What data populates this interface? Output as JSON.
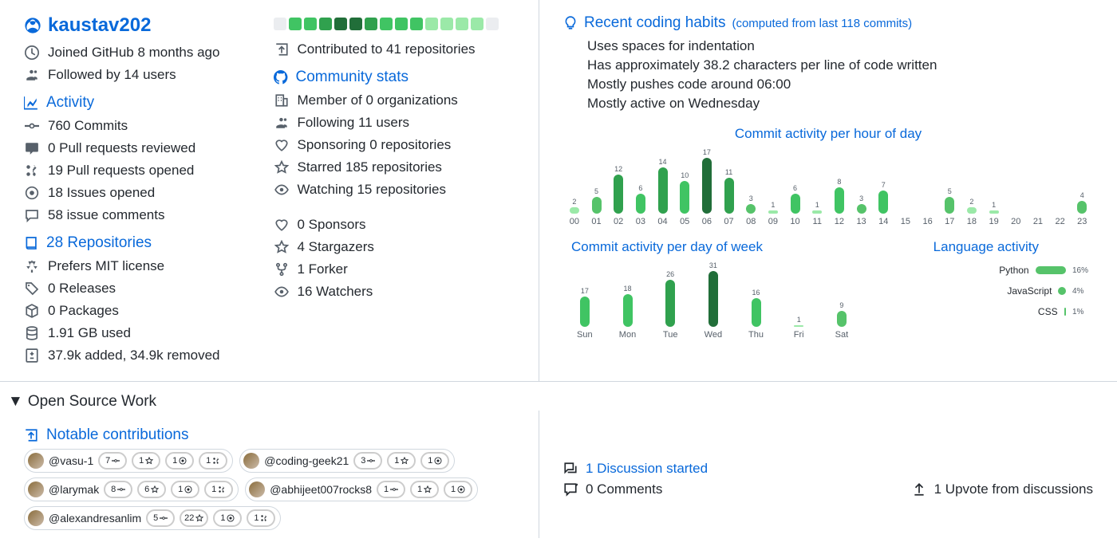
{
  "profile": {
    "username": "kaustav202",
    "joined": "Joined GitHub 8 months ago",
    "followed": "Followed by 14 users",
    "contributed": "Contributed to 41 repositories"
  },
  "activity": {
    "title": "Activity",
    "commits": "760 Commits",
    "pr_reviewed": "0 Pull requests reviewed",
    "pr_opened": "19 Pull requests opened",
    "issues": "18 Issues opened",
    "comments": "58 issue comments"
  },
  "community": {
    "title": "Community stats",
    "orgs": "Member of 0 organizations",
    "following": "Following 11 users",
    "sponsoring": "Sponsoring 0 repositories",
    "starred": "Starred 185 repositories",
    "watching": "Watching 15 repositories"
  },
  "repos": {
    "title": "28 Repositories",
    "license": "Prefers MIT license",
    "releases": "0 Releases",
    "packages": "0 Packages",
    "disk": "1.91 GB used",
    "diff": "37.9k added, 34.9k removed"
  },
  "repostats": {
    "sponsors": "0 Sponsors",
    "stargazers": "4 Stargazers",
    "forker": "1 Forker",
    "watchers": "16 Watchers"
  },
  "squares": [
    "#ebedf0",
    "#40c463",
    "#40c463",
    "#30a14e",
    "#216e39",
    "#216e39",
    "#30a14e",
    "#40c463",
    "#40c463",
    "#40c463",
    "#9be9a8",
    "#9be9a8",
    "#9be9a8",
    "#9be9a8",
    "#ebedf0"
  ],
  "habits": {
    "title": "Recent coding habits",
    "subtitle": "(computed from last 118 commits)",
    "items": [
      "Uses spaces for indentation",
      "Has approximately 38.2 characters per line of code written",
      "Mostly pushes code around 06:00",
      "Mostly active on Wednesday"
    ]
  },
  "chart_data": [
    {
      "type": "bar",
      "title": "Commit activity per hour of day",
      "categories": [
        "00",
        "01",
        "02",
        "03",
        "04",
        "05",
        "06",
        "07",
        "08",
        "09",
        "10",
        "11",
        "12",
        "13",
        "14",
        "15",
        "16",
        "17",
        "18",
        "19",
        "20",
        "21",
        "22",
        "23"
      ],
      "values": [
        2,
        5,
        12,
        6,
        14,
        10,
        17,
        11,
        3,
        1,
        6,
        1,
        8,
        3,
        7,
        0,
        0,
        5,
        2,
        1,
        0,
        0,
        0,
        4
      ],
      "max": 17
    },
    {
      "type": "bar",
      "title": "Commit activity per day of week",
      "categories": [
        "Sun",
        "Mon",
        "Tue",
        "Wed",
        "Thu",
        "Fri",
        "Sat"
      ],
      "values": [
        17,
        18,
        26,
        31,
        16,
        1,
        9
      ],
      "max": 31
    },
    {
      "type": "bar",
      "title": "Language activity",
      "categories": [
        "Python",
        "JavaScript",
        "CSS"
      ],
      "values": [
        16,
        4,
        1
      ],
      "labels": [
        "16%",
        "4%",
        "1%"
      ]
    }
  ],
  "osw": {
    "title": "Open Source Work"
  },
  "contrib": {
    "title": "Notable contributions",
    "items": [
      {
        "name": "@vasu-1",
        "stats": [
          "7",
          "1",
          "1",
          "1"
        ]
      },
      {
        "name": "@coding-geek21",
        "stats": [
          "3",
          "1",
          "1"
        ]
      },
      {
        "name": "@larymak",
        "stats": [
          "8",
          "6",
          "1",
          "1"
        ]
      },
      {
        "name": "@abhijeet007rocks8",
        "stats": [
          "1",
          "1",
          "1"
        ]
      },
      {
        "name": "@alexandresanlim",
        "stats": [
          "5",
          "22",
          "1",
          "1"
        ]
      }
    ]
  },
  "discussions": {
    "started": "1 Discussion started",
    "comments": "0 Comments",
    "upvotes": "1 Upvote from discussions"
  }
}
